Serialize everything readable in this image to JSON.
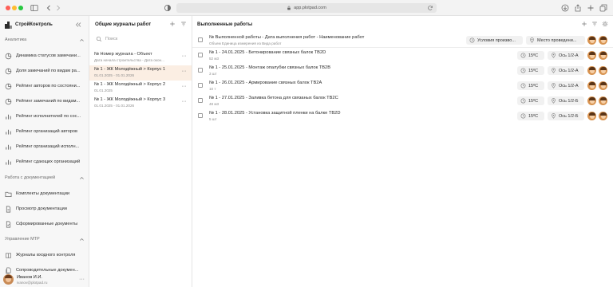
{
  "browser": {
    "url": "app.plotpad.com"
  },
  "sidebar": {
    "brand": "СтройКонтроль",
    "sections": [
      {
        "title": "Аналитика",
        "items": [
          "Динамика статусов замечани...",
          "Доля замечаний по видам ра...",
          "Рейтинг авторов по состояни...",
          "Рейтинг замечаний по видам...",
          "Рейтинг исполнителей по сос...",
          "Рейтинг организаций авторов",
          "Рейтинг организаций исполн...",
          "Рейтинг сдающих организаций"
        ]
      },
      {
        "title": "Работа с документацией",
        "items": [
          "Комплекты документации",
          "Просмотр документации",
          "Сформированные документы"
        ]
      },
      {
        "title": "Управление МТР",
        "items": [
          "Журналы входного контроля",
          "Сопроводительные докумен..."
        ]
      }
    ],
    "user": {
      "name": "Иванов И.И.",
      "email": "ivanov@plotpad.ru"
    }
  },
  "journals": {
    "title": "Общие журналы работ",
    "search_placeholder": "Поиск",
    "header": {
      "title": "№ Номер журнала - Объект",
      "sub": "Дата начала строительства - Дата окон..."
    },
    "items": [
      {
        "title": "№ 1 - ЖК Молодёжный > Корпус 1",
        "sub": "01.01.2025 - 01.01.2026",
        "selected": true
      },
      {
        "title": "№ 1 - ЖК Молодёжный > Корпус 2",
        "sub": "01.01.2025",
        "selected": false
      },
      {
        "title": "№ 1 - ЖК Молодёжный > Корпус 3",
        "sub": "01.01.2025 - 01.01.2026",
        "selected": false
      }
    ]
  },
  "works": {
    "title": "Выполненные работы",
    "header": {
      "title": "№ Выполненной работы - Дата выполнения работ - Наименование работ",
      "sub": "Объем Единица измерения из Вида работ",
      "col_conditions": "Условия произво...",
      "col_place": "Место проведени..."
    },
    "rows": [
      {
        "title": "№ 1 - 24.01.2025 - Бетонирование связных балок ТВ2D",
        "sub": "52 м3",
        "temp": "15ºC",
        "axis": "Ось 1/2-А"
      },
      {
        "title": "№ 1 - 25.01.2025 - Монтаж опалубки связных балок ТВ2В",
        "sub": "3 шт",
        "temp": "15ºC",
        "axis": "Ось 1/2-А"
      },
      {
        "title": "№ 1 - 26.01.2025 - Армирование связных балок ТВ2А",
        "sub": "10 т",
        "temp": "15ºC",
        "axis": "Ось 1/2-А"
      },
      {
        "title": "№ 1 - 27.01.2025 - Заливка бетона для связаных балок ТВ2С",
        "sub": "48 м3",
        "temp": "15ºC",
        "axis": "Ось 1/2-Б"
      },
      {
        "title": "№ 1 - 28.01.2025 - Установка защитной пленки на балке ТВ2D",
        "sub": "5 шт",
        "temp": "15ºC",
        "axis": "Ось 1/2-Б"
      }
    ]
  },
  "colors": {
    "selected_row": "#fbeee3",
    "accent_avatar": "#d89350"
  }
}
